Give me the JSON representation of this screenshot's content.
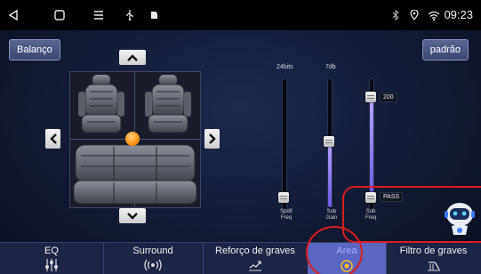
{
  "status_bar": {
    "time": "09:23",
    "left_icons": [
      "back-icon",
      "home-icon",
      "menu-icon",
      "usb-icon",
      "sd-card-icon"
    ],
    "right_icons": [
      "bluetooth-icon",
      "location-icon",
      "wifi-icon"
    ]
  },
  "header": {
    "left_button": "Balanço",
    "right_button": "padrão"
  },
  "car_view": {
    "seat_icon": "car-seat-icon",
    "focus_point_icon": "focus-dot-icon",
    "nav_icons": [
      "arrow-up-icon",
      "arrow-down-icon",
      "arrow-left-icon",
      "arrow-right-icon"
    ]
  },
  "sliders": [
    {
      "top_value": "24bits",
      "name_lines": [
        "Spdif",
        "Freq"
      ],
      "level": 0.0
    },
    {
      "top_value": "7db",
      "name_lines": [
        "Sub",
        "Gain"
      ],
      "level": 0.45
    },
    {
      "top_value": "",
      "name_lines": [
        "Sub",
        "Freq"
      ],
      "level_top": 0.83,
      "level_bottom": 0.0,
      "tag_top": "200",
      "tag_bottom": "PASS"
    }
  ],
  "assistant_icon": "robot-assistant-icon",
  "tabs": [
    {
      "label": "EQ",
      "icon": "equalizer-sliders-icon",
      "active": false
    },
    {
      "label": "Surround",
      "icon": "surround-sound-icon",
      "active": false
    },
    {
      "label": "Reforço de graves",
      "icon": "bass-boost-icon",
      "active": false
    },
    {
      "label": "Area",
      "icon": "area-target-icon",
      "active": true
    },
    {
      "label": "Filtro de graves",
      "icon": "bass-filter-icon",
      "active": false
    }
  ],
  "colors": {
    "accent": "#5a66c0",
    "slider_fill": "#7a6cf0",
    "focus_dot": "#ff9a1a",
    "annotation": "#d61f1f"
  }
}
